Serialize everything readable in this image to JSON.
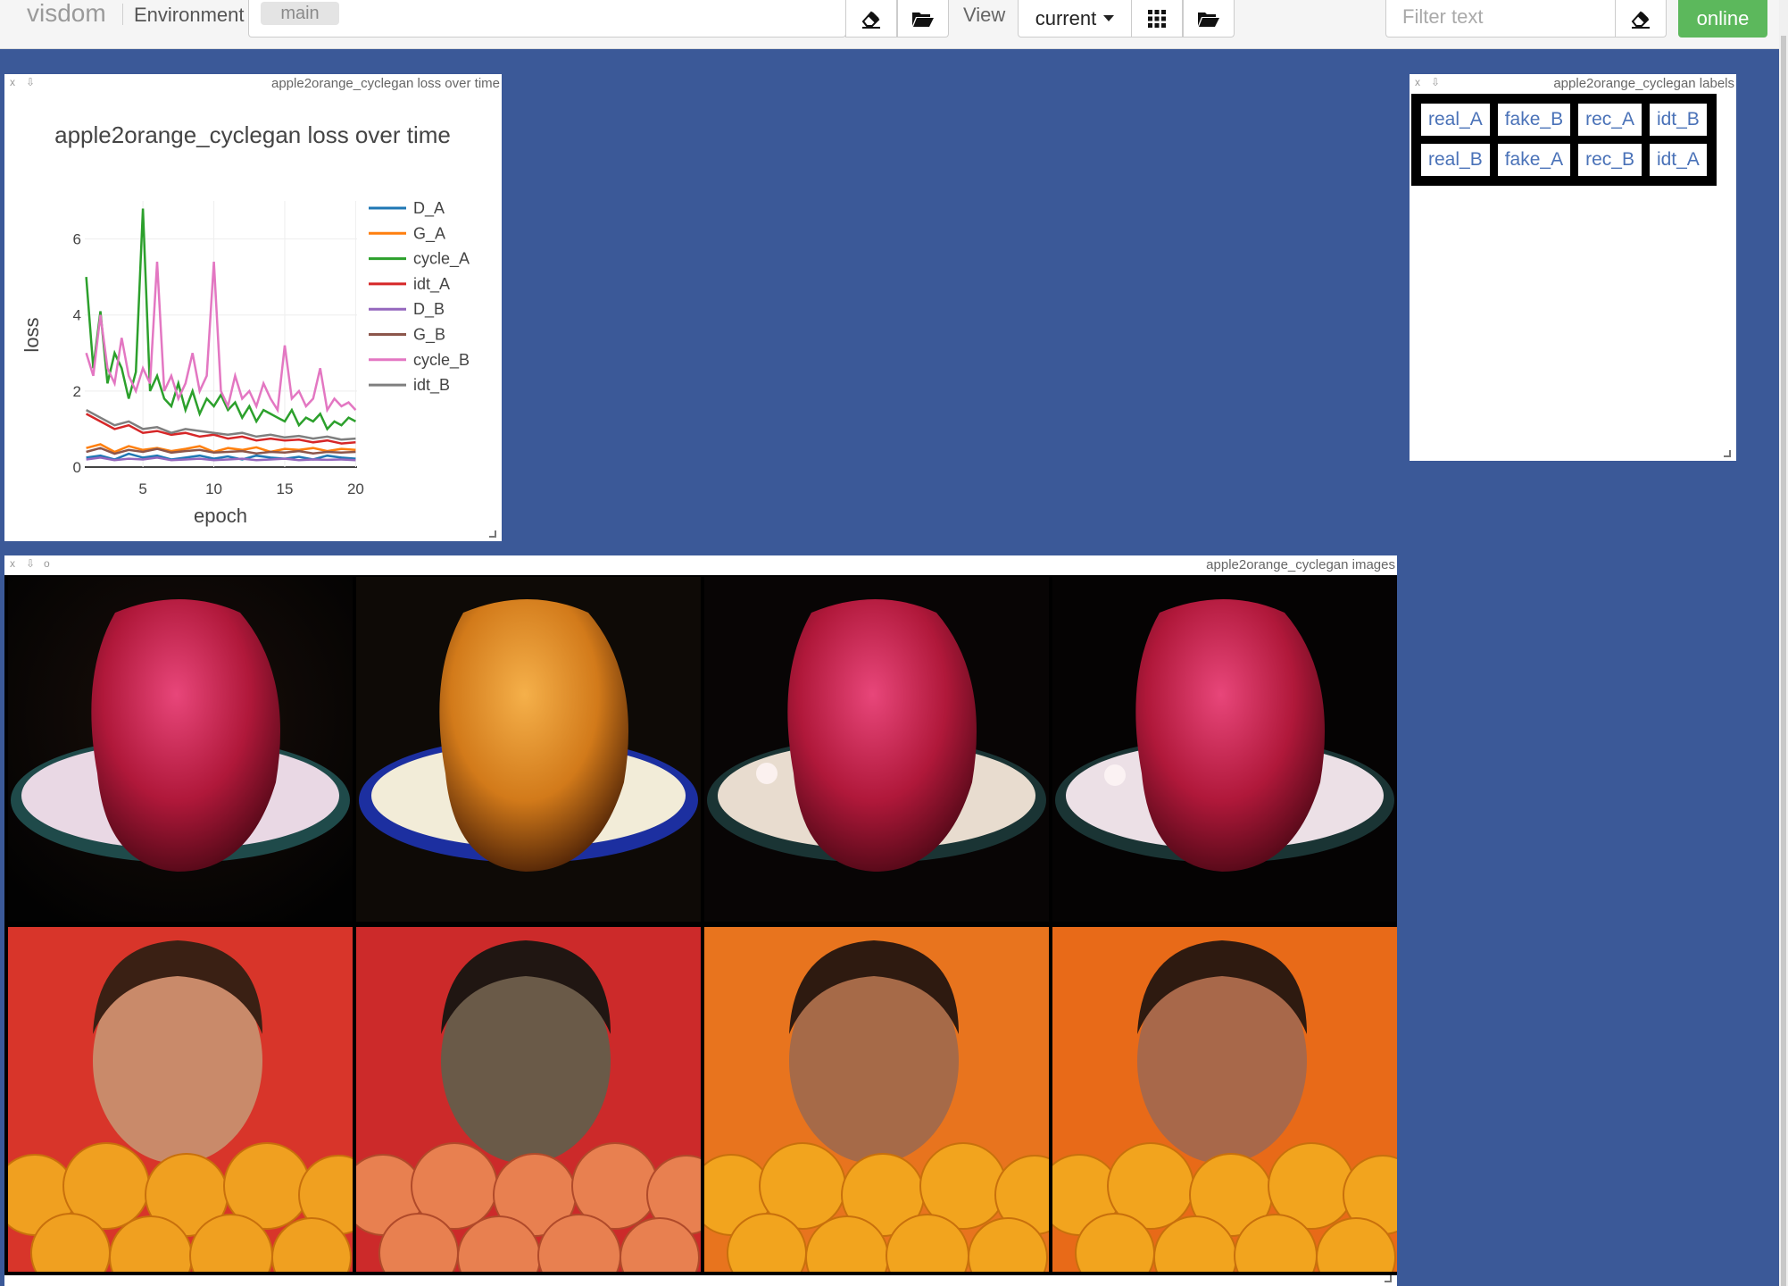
{
  "navbar": {
    "brand": "visdom",
    "environment_label": "Environment",
    "environment_value": "main",
    "clear_symbol": "×",
    "view_label": "View",
    "view_value": "current",
    "filter_placeholder": "Filter text",
    "status": "online",
    "icons": [
      "eraser-icon",
      "folder-open-icon",
      "grid-icon",
      "folder-open-icon",
      "eraser-icon"
    ]
  },
  "colors": {
    "background": "#3b5998",
    "online": "#5cb85c",
    "label_link": "#4a72b8"
  },
  "loss_pane": {
    "window_title": "apple2orange_cyclegan loss over time",
    "close": "x",
    "download": "⇩",
    "chart_data": {
      "type": "line",
      "title": "apple2orange_cyclegan loss over time",
      "xlabel": "epoch",
      "ylabel": "loss",
      "xlim": [
        0.9,
        20.1
      ],
      "ylim": [
        0,
        7
      ],
      "xticks": [
        5,
        10,
        15,
        20
      ],
      "yticks": [
        0,
        2,
        4,
        6
      ],
      "grid": true,
      "legend_position": "right",
      "series": [
        {
          "name": "D_A",
          "color": "#1f77b4",
          "x": [
            1,
            2,
            3,
            4,
            5,
            6,
            7,
            8,
            9,
            10,
            11,
            12,
            13,
            14,
            15,
            16,
            17,
            18,
            19,
            20
          ],
          "y": [
            0.25,
            0.3,
            0.2,
            0.35,
            0.25,
            0.3,
            0.2,
            0.25,
            0.3,
            0.22,
            0.28,
            0.2,
            0.3,
            0.25,
            0.22,
            0.27,
            0.2,
            0.3,
            0.25,
            0.22
          ]
        },
        {
          "name": "G_A",
          "color": "#ff7f0e",
          "x": [
            1,
            2,
            3,
            4,
            5,
            6,
            7,
            8,
            9,
            10,
            11,
            12,
            13,
            14,
            15,
            16,
            17,
            18,
            19,
            20
          ],
          "y": [
            0.5,
            0.6,
            0.4,
            0.55,
            0.45,
            0.5,
            0.42,
            0.48,
            0.55,
            0.4,
            0.5,
            0.45,
            0.52,
            0.4,
            0.48,
            0.45,
            0.5,
            0.42,
            0.48,
            0.45
          ]
        },
        {
          "name": "cycle_A",
          "color": "#2ca02c",
          "x": [
            1,
            1.5,
            2,
            2.5,
            3,
            3.5,
            4,
            4.5,
            5,
            5.5,
            6,
            6.5,
            7,
            7.5,
            8,
            8.5,
            9,
            9.5,
            10,
            10.5,
            11,
            11.5,
            12,
            12.5,
            13,
            13.5,
            14,
            14.5,
            15,
            15.5,
            16,
            16.5,
            17,
            17.5,
            18,
            18.5,
            19,
            19.5,
            20
          ],
          "y": [
            5.0,
            2.6,
            4.1,
            2.2,
            3.0,
            2.6,
            1.8,
            2.5,
            6.8,
            2.0,
            2.4,
            1.8,
            1.6,
            2.2,
            1.5,
            2.0,
            1.4,
            1.8,
            1.6,
            1.9,
            1.5,
            1.7,
            1.3,
            1.6,
            1.2,
            1.5,
            1.4,
            1.3,
            1.2,
            1.5,
            1.1,
            1.3,
            1.2,
            1.4,
            1.0,
            1.2,
            1.1,
            1.3,
            1.2
          ]
        },
        {
          "name": "idt_A",
          "color": "#d62728",
          "x": [
            1,
            2,
            3,
            4,
            5,
            6,
            7,
            8,
            9,
            10,
            11,
            12,
            13,
            14,
            15,
            16,
            17,
            18,
            19,
            20
          ],
          "y": [
            1.4,
            1.2,
            1.0,
            1.1,
            0.9,
            0.95,
            0.85,
            0.9,
            0.8,
            0.85,
            0.75,
            0.8,
            0.7,
            0.75,
            0.7,
            0.72,
            0.65,
            0.7,
            0.62,
            0.65
          ]
        },
        {
          "name": "D_B",
          "color": "#9467bd",
          "x": [
            1,
            2,
            3,
            4,
            5,
            6,
            7,
            8,
            9,
            10,
            11,
            12,
            13,
            14,
            15,
            16,
            17,
            18,
            19,
            20
          ],
          "y": [
            0.2,
            0.25,
            0.18,
            0.22,
            0.2,
            0.25,
            0.18,
            0.2,
            0.22,
            0.18,
            0.2,
            0.22,
            0.18,
            0.2,
            0.22,
            0.18,
            0.2,
            0.19,
            0.2,
            0.18
          ]
        },
        {
          "name": "G_B",
          "color": "#8c564b",
          "x": [
            1,
            2,
            3,
            4,
            5,
            6,
            7,
            8,
            9,
            10,
            11,
            12,
            13,
            14,
            15,
            16,
            17,
            18,
            19,
            20
          ],
          "y": [
            0.4,
            0.5,
            0.35,
            0.45,
            0.4,
            0.48,
            0.38,
            0.42,
            0.45,
            0.38,
            0.4,
            0.42,
            0.36,
            0.4,
            0.38,
            0.42,
            0.36,
            0.4,
            0.38,
            0.4
          ]
        },
        {
          "name": "cycle_B",
          "color": "#e377c2",
          "x": [
            1,
            1.5,
            2,
            2.5,
            3,
            3.5,
            4,
            4.5,
            5,
            5.5,
            6,
            6.5,
            7,
            7.5,
            8,
            8.5,
            9,
            9.5,
            10,
            10.5,
            11,
            11.5,
            12,
            12.5,
            13,
            13.5,
            14,
            14.5,
            15,
            15.5,
            16,
            16.5,
            17,
            17.5,
            18,
            18.5,
            19,
            19.5,
            20
          ],
          "y": [
            3.0,
            2.4,
            4.0,
            2.6,
            2.2,
            3.4,
            2.4,
            2.0,
            2.6,
            2.2,
            5.4,
            2.0,
            2.4,
            1.8,
            2.2,
            3.0,
            2.0,
            2.4,
            5.4,
            2.0,
            1.6,
            2.4,
            1.8,
            2.0,
            1.6,
            2.2,
            1.8,
            1.5,
            3.2,
            1.8,
            2.0,
            1.6,
            1.8,
            2.6,
            1.5,
            1.8,
            1.6,
            1.7,
            1.5
          ]
        },
        {
          "name": "idt_B",
          "color": "#7f7f7f",
          "x": [
            1,
            2,
            3,
            4,
            5,
            6,
            7,
            8,
            9,
            10,
            11,
            12,
            13,
            14,
            15,
            16,
            17,
            18,
            19,
            20
          ],
          "y": [
            1.5,
            1.3,
            1.1,
            1.2,
            1.0,
            1.05,
            0.9,
            1.0,
            0.95,
            0.9,
            0.85,
            0.9,
            0.8,
            0.85,
            0.78,
            0.82,
            0.75,
            0.8,
            0.72,
            0.75
          ]
        }
      ]
    }
  },
  "labels_pane": {
    "window_title": "apple2orange_cyclegan labels",
    "close": "x",
    "download": "⇩",
    "rows": [
      [
        "real_A",
        "fake_B",
        "rec_A",
        "idt_B"
      ],
      [
        "real_B",
        "fake_A",
        "rec_B",
        "idt_A"
      ]
    ]
  },
  "images_pane": {
    "window_title": "apple2orange_cyclegan images",
    "close": "x",
    "download": "⇩",
    "reset": "o",
    "grid": [
      [
        "real_A",
        "fake_B",
        "rec_A",
        "idt_B"
      ],
      [
        "real_B",
        "fake_A",
        "rec_B",
        "idt_A"
      ]
    ]
  }
}
